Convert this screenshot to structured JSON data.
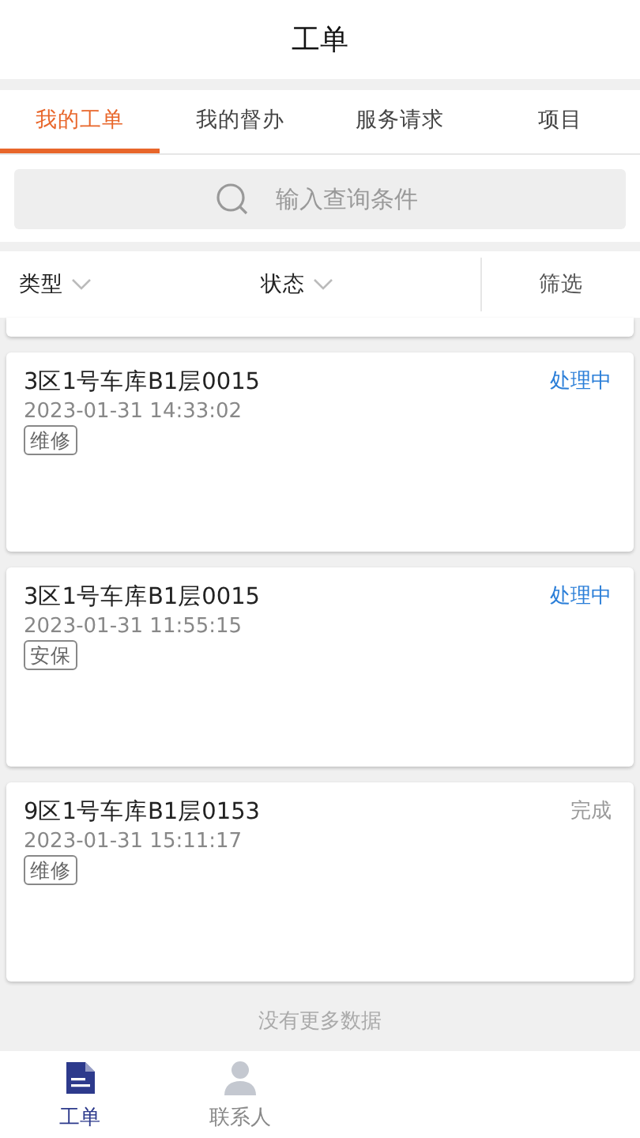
{
  "header": {
    "title": "工单"
  },
  "tabs": [
    {
      "label": "我的工单",
      "selected": true
    },
    {
      "label": "我的督办",
      "selected": false
    },
    {
      "label": "服务请求",
      "selected": false
    },
    {
      "label": "项目",
      "selected": false
    }
  ],
  "search": {
    "placeholder": "输入查询条件"
  },
  "filters": [
    {
      "label": "类型"
    },
    {
      "label": "状态"
    }
  ],
  "filter_button": "筛选",
  "orders": [
    {
      "title": "3区1号车库B1层0015",
      "time": "2023-01-31 14:33:02",
      "tag": "维修",
      "status": "处理中",
      "kind": "processing"
    },
    {
      "title": "3区1号车库B1层0015",
      "time": "2023-01-31 11:55:15",
      "tag": "安保",
      "status": "处理中",
      "kind": "processing"
    },
    {
      "title": "9区1号车库B1层0153",
      "time": "2023-01-31 15:11:17",
      "tag": "维修",
      "status": "完成",
      "kind": "done"
    }
  ],
  "end_note": "没有更多数据",
  "bottom_nav": [
    {
      "label": "工单",
      "kind": "document",
      "selected": true
    },
    {
      "label": "联系人",
      "kind": "person",
      "selected": false
    }
  ]
}
